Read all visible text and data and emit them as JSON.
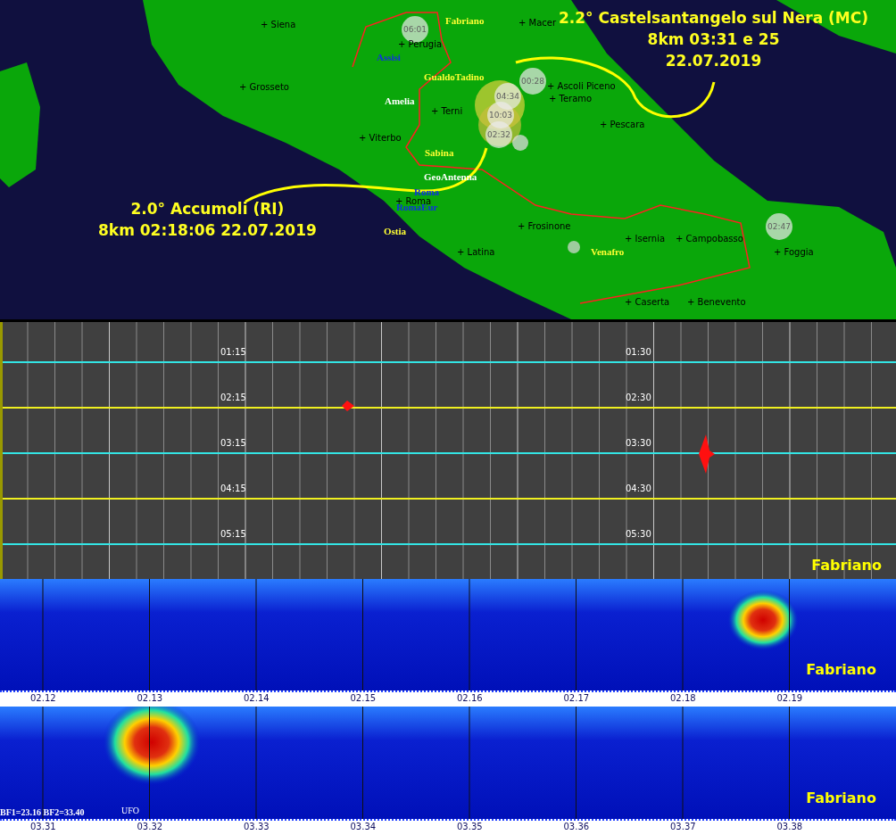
{
  "map": {
    "cities": [
      "+ Siena",
      "+ Macer",
      "+ Perugia",
      "+ Grosseto",
      "+ Ascoli Piceno",
      "+ Teramo",
      "+ Terni",
      "+ Pescara",
      "+ Viterbo",
      "+ Roma",
      "+ Frosinone",
      "+ Latina",
      "+ Isernia",
      "+ Campobasso",
      "+ Foggia",
      "+ Caserta",
      "+ Benevento"
    ],
    "stations": [
      {
        "name": "Fabriano",
        "color": "#ffff33"
      },
      {
        "name": "Assisi",
        "color": "#1030e0"
      },
      {
        "name": "GualdoTadino",
        "color": "#ffff33"
      },
      {
        "name": "Amelia",
        "color": "#ffffff"
      },
      {
        "name": "Sabina",
        "color": "#ffff33"
      },
      {
        "name": "GeoAntenna",
        "color": "#ffffff"
      },
      {
        "name": "Roma",
        "color": "#1030e0"
      },
      {
        "name": "RomaEur",
        "color": "#1030e0"
      },
      {
        "name": "Ostia",
        "color": "#ffff33"
      },
      {
        "name": "Venafro",
        "color": "#ffff33"
      }
    ],
    "event_times": [
      "06:01",
      "00:28",
      "04:34",
      "10:03",
      "02:32",
      "02:47"
    ],
    "annotations": [
      {
        "lines": [
          "2.2° Castelsantangelo sul Nera (MC)",
          "8km 03:31 e 25",
          "22.07.2019"
        ]
      },
      {
        "lines": [
          "2.0°  Accumoli (RI)",
          "8km 02:18:06 22.07.2019"
        ]
      }
    ]
  },
  "seismogram": {
    "station": "Fabriano",
    "rows": [
      {
        "left": "01:15",
        "right": "01:30",
        "color": "#33e5e5"
      },
      {
        "left": "02:15",
        "right": "02:30",
        "color": "#f0f020"
      },
      {
        "left": "03:15",
        "right": "03:30",
        "color": "#33e5e5"
      },
      {
        "left": "04:15",
        "right": "04:30",
        "color": "#f0f020"
      },
      {
        "left": "05:15",
        "right": "05:30",
        "color": "#33e5e5"
      }
    ]
  },
  "spectrograms": [
    {
      "station": "Fabriano",
      "times": [
        "02.12",
        "02.13",
        "02.14",
        "02.15",
        "02.16",
        "02.17",
        "02.18",
        "02.19"
      ]
    },
    {
      "station": "Fabriano",
      "info": "BF1=23.16 BF2=33.40",
      "mark": "UFO",
      "times": [
        "03.31",
        "03.32",
        "03.33",
        "03.34",
        "03.35",
        "03.36",
        "03.37",
        "03.38"
      ]
    }
  ]
}
